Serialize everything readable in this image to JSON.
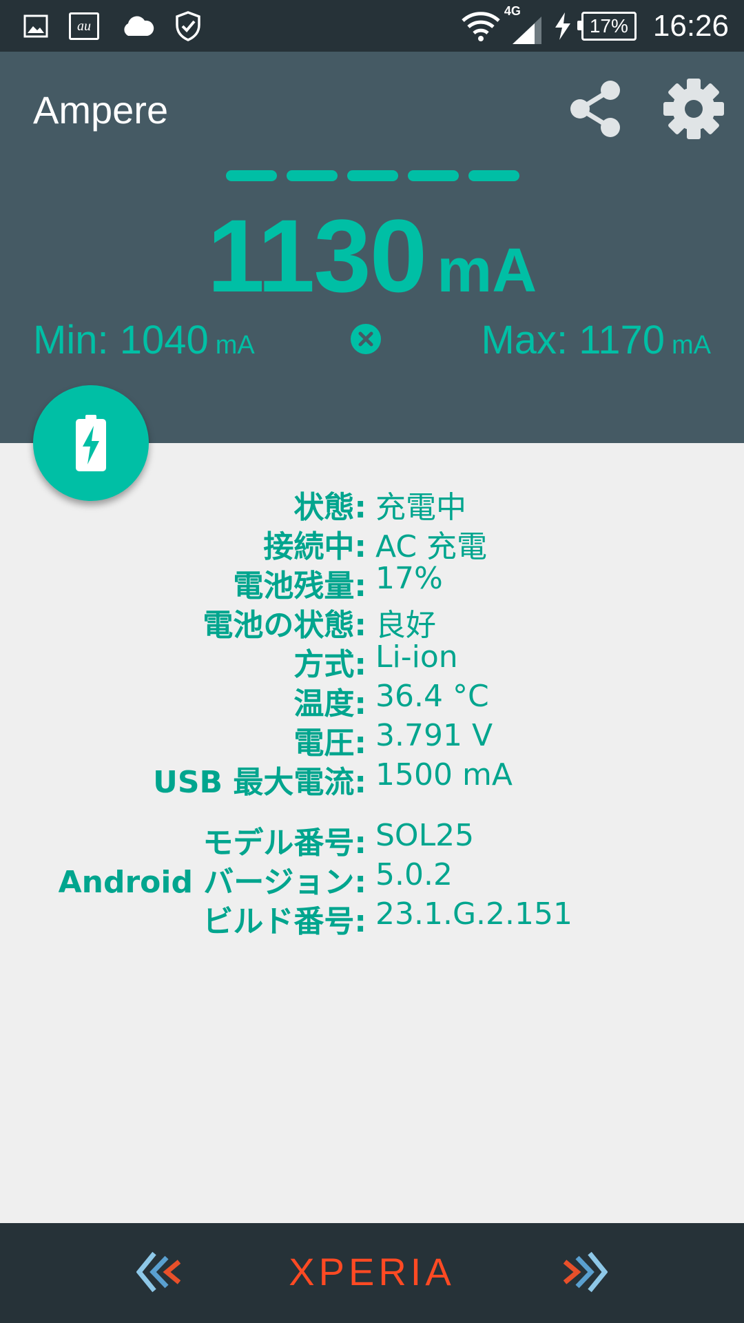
{
  "status_bar": {
    "network_type": "4G",
    "battery_percent": "17%",
    "time": "16:26",
    "carrier_icon_text": "au"
  },
  "app": {
    "title": "Ampere",
    "current": {
      "value": "1130",
      "unit": "mA"
    },
    "min": {
      "label": "Min: ",
      "value": "1040",
      "unit": "mA"
    },
    "max": {
      "label": "Max: ",
      "value": "1170",
      "unit": "mA"
    },
    "accent_color": "#00bfa5",
    "header_color": "#455a64"
  },
  "info": {
    "rows": [
      {
        "label": "状態:",
        "value": "充電中"
      },
      {
        "label": "接続中:",
        "value": "AC 充電"
      },
      {
        "label": "電池残量:",
        "value": "17%"
      },
      {
        "label": "電池の状態:",
        "value": "良好"
      },
      {
        "label": "方式:",
        "value": "Li-ion"
      },
      {
        "label": "温度:",
        "value": "36.4 °C"
      },
      {
        "label": "電圧:",
        "value": "3.791 V"
      },
      {
        "label": "USB 最大電流:",
        "value": "1500 mA"
      },
      {
        "label": "モデル番号:",
        "value": "SOL25"
      },
      {
        "label": "Android バージョン:",
        "value": "5.0.2"
      },
      {
        "label": "ビルド番号:",
        "value": "23.1.G.2.151"
      }
    ]
  },
  "nav_bar": {
    "brand": "XPERIA",
    "brand_color": "#ff4a23"
  }
}
